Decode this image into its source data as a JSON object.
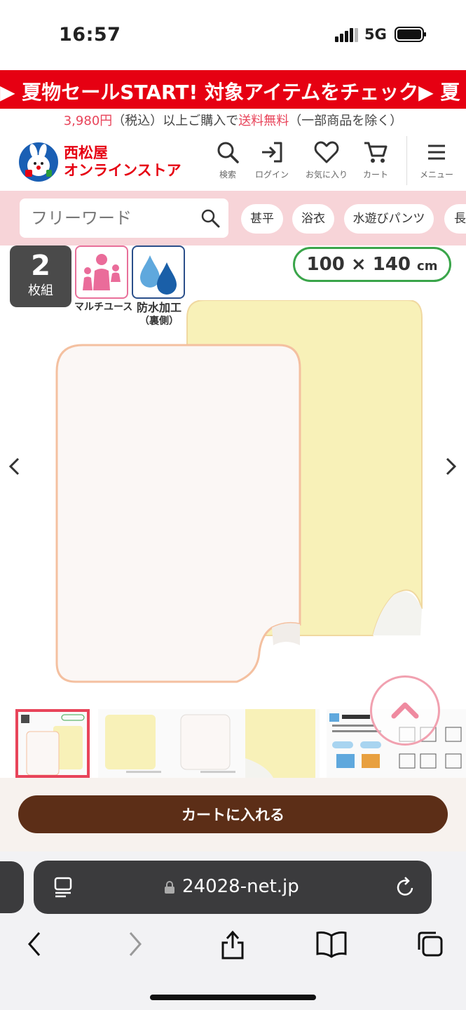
{
  "status_bar": {
    "time": "16:57",
    "network": "5G"
  },
  "banner": {
    "text": "▶ 夏物セールSTART! 対象アイテムをチェック▶ 夏"
  },
  "shipping": {
    "price": "3,980円",
    "tax": "（税込）以上ご購入で",
    "free": "送料無料",
    "note": "（一部商品を除く）"
  },
  "header": {
    "logo_line1": "西松屋",
    "logo_line2": "オンラインストア",
    "search_label": "検索",
    "login_label": "ログイン",
    "favorite_label": "お気に入り",
    "cart_label": "カート",
    "menu_label": "メニュー"
  },
  "search": {
    "placeholder": "フリーワード",
    "chips": [
      "甚平",
      "浴衣",
      "水遊びパンツ",
      "長"
    ]
  },
  "product": {
    "set_count": "2",
    "set_unit": "枚組",
    "feature_multi": "マルチユース",
    "feature_waterproof": "防水加工",
    "feature_waterproof_note": "（裏側）",
    "size": "100 × 140",
    "size_unit": "cm"
  },
  "cart": {
    "button_label": "カートに入れる"
  },
  "browser": {
    "url": "24028-net.jp"
  },
  "colors": {
    "brand_red": "#e60012",
    "accent_pink": "#e8445a",
    "cart_brown": "#5c2e17",
    "search_bg": "#f7d4d8"
  }
}
